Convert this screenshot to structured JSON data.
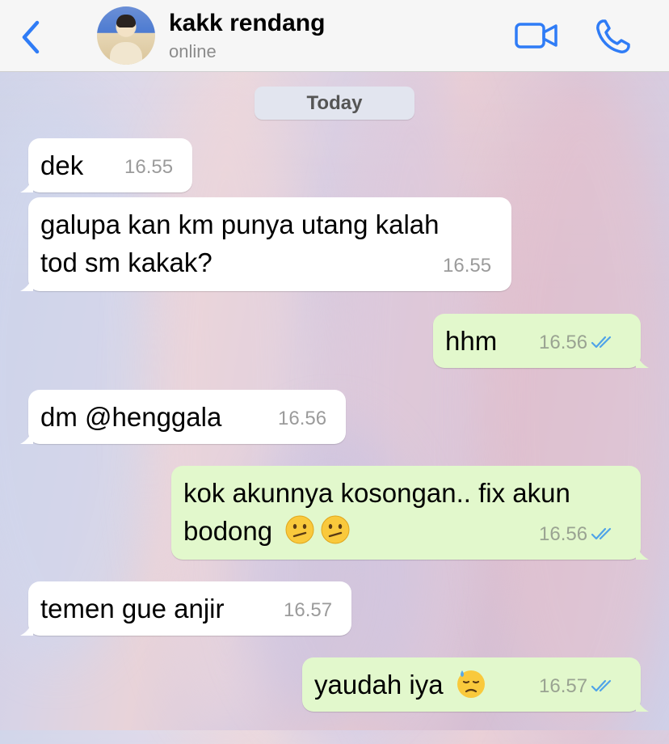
{
  "header": {
    "contact_name": "kakk rendang",
    "status": "online",
    "back_icon": "chevron-left-icon",
    "video_icon": "video-camera-icon",
    "call_icon": "phone-icon",
    "accent_color": "#2f7cf6"
  },
  "date_divider": "Today",
  "messages": [
    {
      "direction": "in",
      "text_lines": [
        "dek"
      ],
      "time": "16.55"
    },
    {
      "direction": "in",
      "text_lines": [
        "galupa kan km punya utang kalah",
        "tod sm kakak?"
      ],
      "time": "16.55"
    },
    {
      "direction": "out",
      "text_lines": [
        "hhm"
      ],
      "time": "16.56",
      "read": true
    },
    {
      "direction": "in",
      "text_lines": [
        "dm @henggala"
      ],
      "time": "16.56"
    },
    {
      "direction": "out",
      "text_lines": [
        "kok akunnya kosongan.. fix akun",
        "bodong"
      ],
      "emojis": [
        "confused-face",
        "confused-face"
      ],
      "time": "16.56",
      "read": true
    },
    {
      "direction": "in",
      "text_lines": [
        "temen gue anjir"
      ],
      "time": "16.57"
    },
    {
      "direction": "out",
      "text_lines": [
        "yaudah iya"
      ],
      "emojis": [
        "downcast-face-with-sweat"
      ],
      "time": "16.57",
      "read": true
    }
  ],
  "colors": {
    "incoming_bubble": "#ffffff",
    "outgoing_bubble": "#e2f8cc",
    "read_ticks": "#4fa3e8"
  }
}
